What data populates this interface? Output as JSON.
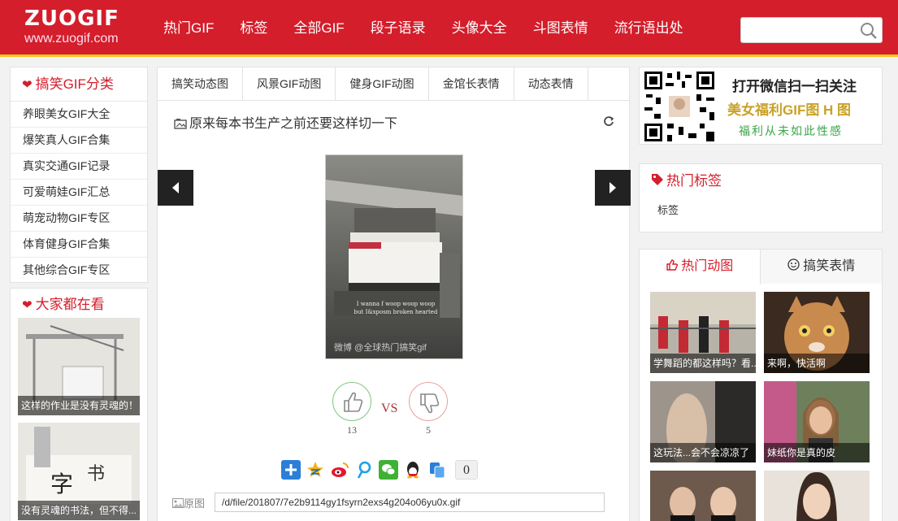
{
  "header": {
    "logo_main": "ZUOGIF",
    "logo_sub": "www.zuogif.com",
    "nav": [
      "热门GIF",
      "标签",
      "全部GIF",
      "段子语录",
      "头像大全",
      "斗图表情",
      "流行语出处"
    ],
    "search_placeholder": ""
  },
  "categories": {
    "title": "搞笑GIF分类",
    "items": [
      "养眼美女GIF大全",
      "爆笑真人GIF合集",
      "真实交通GIF记录",
      "可爱萌娃GIF汇总",
      "萌宠动物GIF专区",
      "体育健身GIF合集",
      "其他综合GIF专区"
    ]
  },
  "watching": {
    "title": "大家都在看",
    "items": [
      "这样的作业是没有灵魂的！",
      "没有灵魂的书法，但不得..."
    ]
  },
  "center": {
    "tabs": [
      "搞笑动态图",
      "风景GIF动图",
      "健身GIF动图",
      "金馆长表情",
      "动态表情"
    ],
    "post_title": "原来每本书生产之前还要这样切一下",
    "gif_caption_1": "I wanna f woop woop woop",
    "gif_caption_2": "but I&xposm broken hearted",
    "gif_watermark": "微博 @全球热门搞笑gif",
    "likes": "13",
    "vs": "VS",
    "dislikes": "5",
    "share_count": "0",
    "original_label": "原图",
    "original_url": "/d/file/201807/7e2b9114gy1fsyrn2exs4g204o06yu0x.gif"
  },
  "qr": {
    "line1": "打开微信扫一扫关注",
    "line2": "美女福利GIF图 H 图",
    "line3": "福利从未如此性感"
  },
  "hot_tags": {
    "title": "热门标签",
    "items": [
      "标签"
    ]
  },
  "hot_gifs": {
    "tab_active": "热门动图",
    "tab_inactive": "搞笑表情",
    "items": [
      "学舞蹈的都这样吗？看...",
      "来啊，快活啊",
      "这玩法...会不会凉凉了",
      "妹纸你是真的皮",
      "",
      ""
    ]
  },
  "colors": {
    "brand_red": "#d41e2b",
    "brand_yellow": "#f4c61a"
  }
}
